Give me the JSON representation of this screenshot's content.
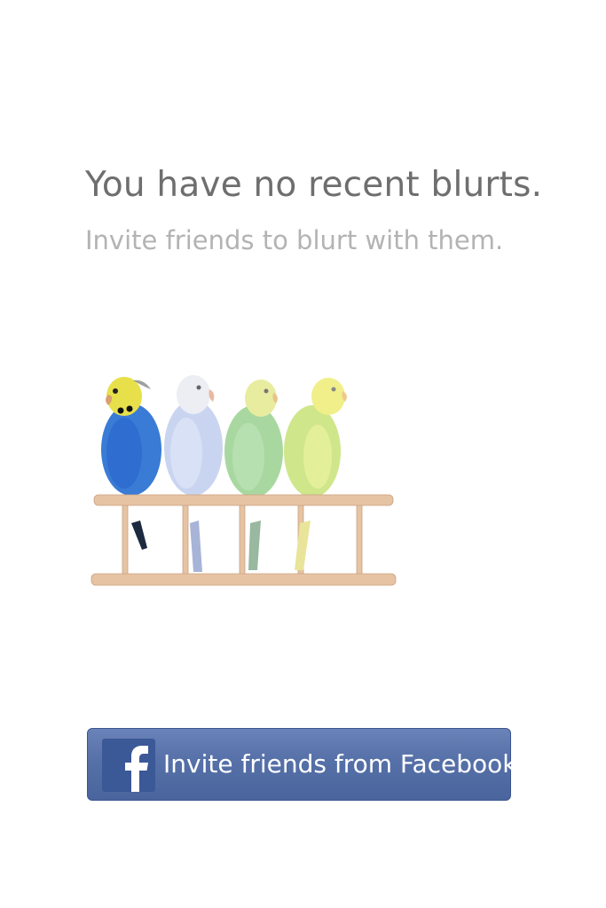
{
  "empty_state": {
    "title": "You have no recent blurts.",
    "subtitle": "Invite friends to blurt with them."
  },
  "illustration": {
    "subject": "budgies-on-perch",
    "colors": {
      "blue_budgie": "#3a7bd5",
      "white_budgie": "#c9d5f0",
      "green_budgie": "#a8d8a0",
      "yellow_budgie": "#d4ea8a",
      "perch_wood": "#e6c3a3"
    }
  },
  "invite_button": {
    "label": "Invite friends from Facebook",
    "icon": "facebook-icon",
    "color": "#5670a8"
  }
}
